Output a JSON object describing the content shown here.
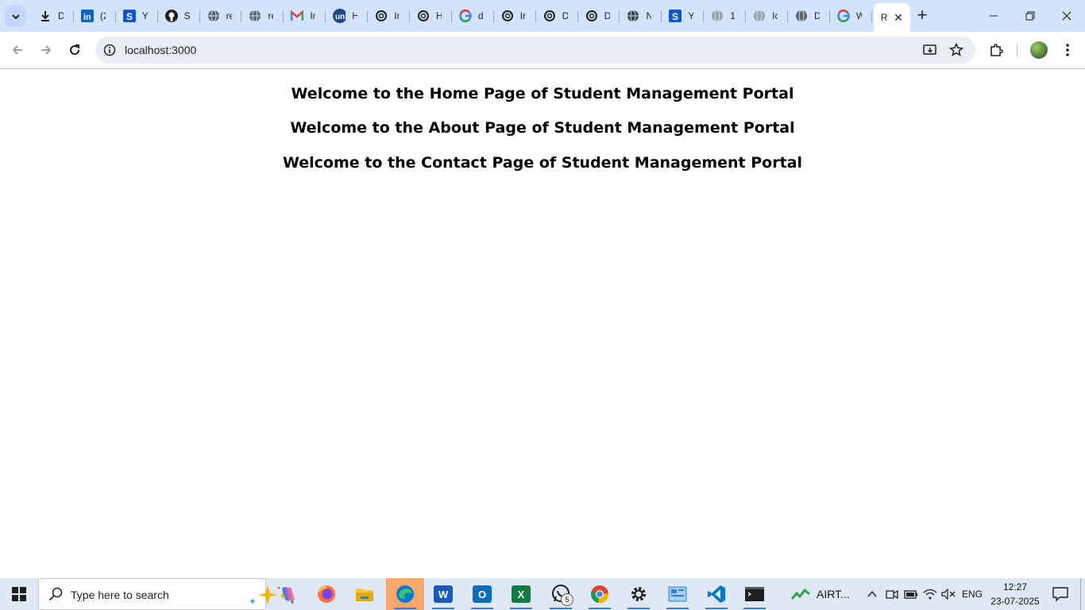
{
  "browser": {
    "tabs": [
      {
        "icon": "download-icon",
        "title": "D"
      },
      {
        "icon": "linkedin-icon",
        "title": "(2"
      },
      {
        "icon": "stackoverflow-s-icon",
        "title": "Y"
      },
      {
        "icon": "github-icon",
        "title": "S"
      },
      {
        "icon": "globe-icon",
        "title": "re"
      },
      {
        "icon": "globe-icon",
        "title": "re"
      },
      {
        "icon": "gmail-icon",
        "title": "In"
      },
      {
        "icon": "unstop-icon",
        "title": "H"
      },
      {
        "icon": "openai-icon",
        "title": "In"
      },
      {
        "icon": "openai-icon",
        "title": "H"
      },
      {
        "icon": "google-icon",
        "title": "d"
      },
      {
        "icon": "openai-icon",
        "title": "In"
      },
      {
        "icon": "openai-icon",
        "title": "D"
      },
      {
        "icon": "openai-icon",
        "title": "D"
      },
      {
        "icon": "globe-icon",
        "title": "N"
      },
      {
        "icon": "stackoverflow-s-icon",
        "title": "Y"
      },
      {
        "icon": "globe-icon",
        "title": "1"
      },
      {
        "icon": "globe-icon",
        "title": "Ic"
      },
      {
        "icon": "globe-icon",
        "title": "D"
      },
      {
        "icon": "google-icon",
        "title": "W"
      }
    ],
    "active_tab": {
      "title": "R"
    },
    "address": "localhost:3000"
  },
  "page": {
    "headings": [
      "Welcome to the Home Page of Student Management Portal",
      "Welcome to the About Page of Student Management Portal",
      "Welcome to the Contact Page of Student Management Portal"
    ]
  },
  "taskbar": {
    "search_placeholder": "Type here to search",
    "whatsapp_badge": "5",
    "weather_label": "AIRT...",
    "language": "ENG",
    "time": "12:27",
    "date": "23-07-2025"
  },
  "colors": {
    "tabstrip": "#d3e3fd",
    "omnibox": "#e9eef6",
    "taskbar": "#dfe9f5",
    "accent": "#0b57d0"
  }
}
